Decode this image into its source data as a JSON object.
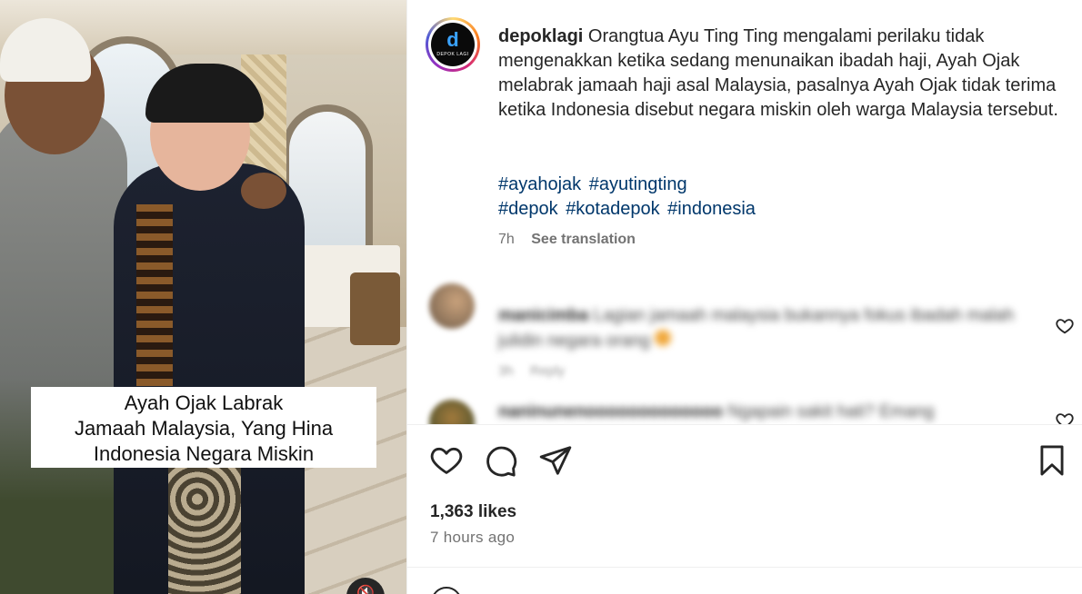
{
  "media": {
    "caption_lines": [
      "Ayah Ojak Labrak",
      "Jamaah Malaysia, Yang Hina",
      "Indonesia Negara Miskin"
    ],
    "mute_icon": "speaker-muted-icon"
  },
  "post": {
    "avatar_letter": "d",
    "avatar_text": "DEPOK LAGI",
    "username": "depoklagi",
    "caption": "Orangtua Ayu Ting Ting mengalami perilaku tidak mengenakkan ketika sedang menunaikan ibadah haji, Ayah Ojak melabrak jamaah haji asal Malaysia, pasalnya Ayah Ojak tidak terima ketika Indonesia disebut negara miskin oleh warga Malaysia tersebut.",
    "hashtags": [
      "#ayahojak",
      "#ayutingting",
      "#depok",
      "#kotadepok",
      "#indonesia"
    ],
    "age": "7h",
    "see_translation": "See translation"
  },
  "comments": [
    {
      "username": "manicimba",
      "text": "Lagian jamaah malaysia bukannya fokus ibadah malah julidin negara orang",
      "age": "3h",
      "reply": "Reply"
    },
    {
      "username": "naninunenooooooooooooo",
      "text": "Ngapain sakit hati? Emang",
      "age": "",
      "reply": ""
    }
  ],
  "footer": {
    "likes": "1,363 likes",
    "time_ago": "7 hours ago"
  },
  "colors": {
    "hashtag": "#00376b",
    "muted": "#737373",
    "text": "#262626"
  }
}
